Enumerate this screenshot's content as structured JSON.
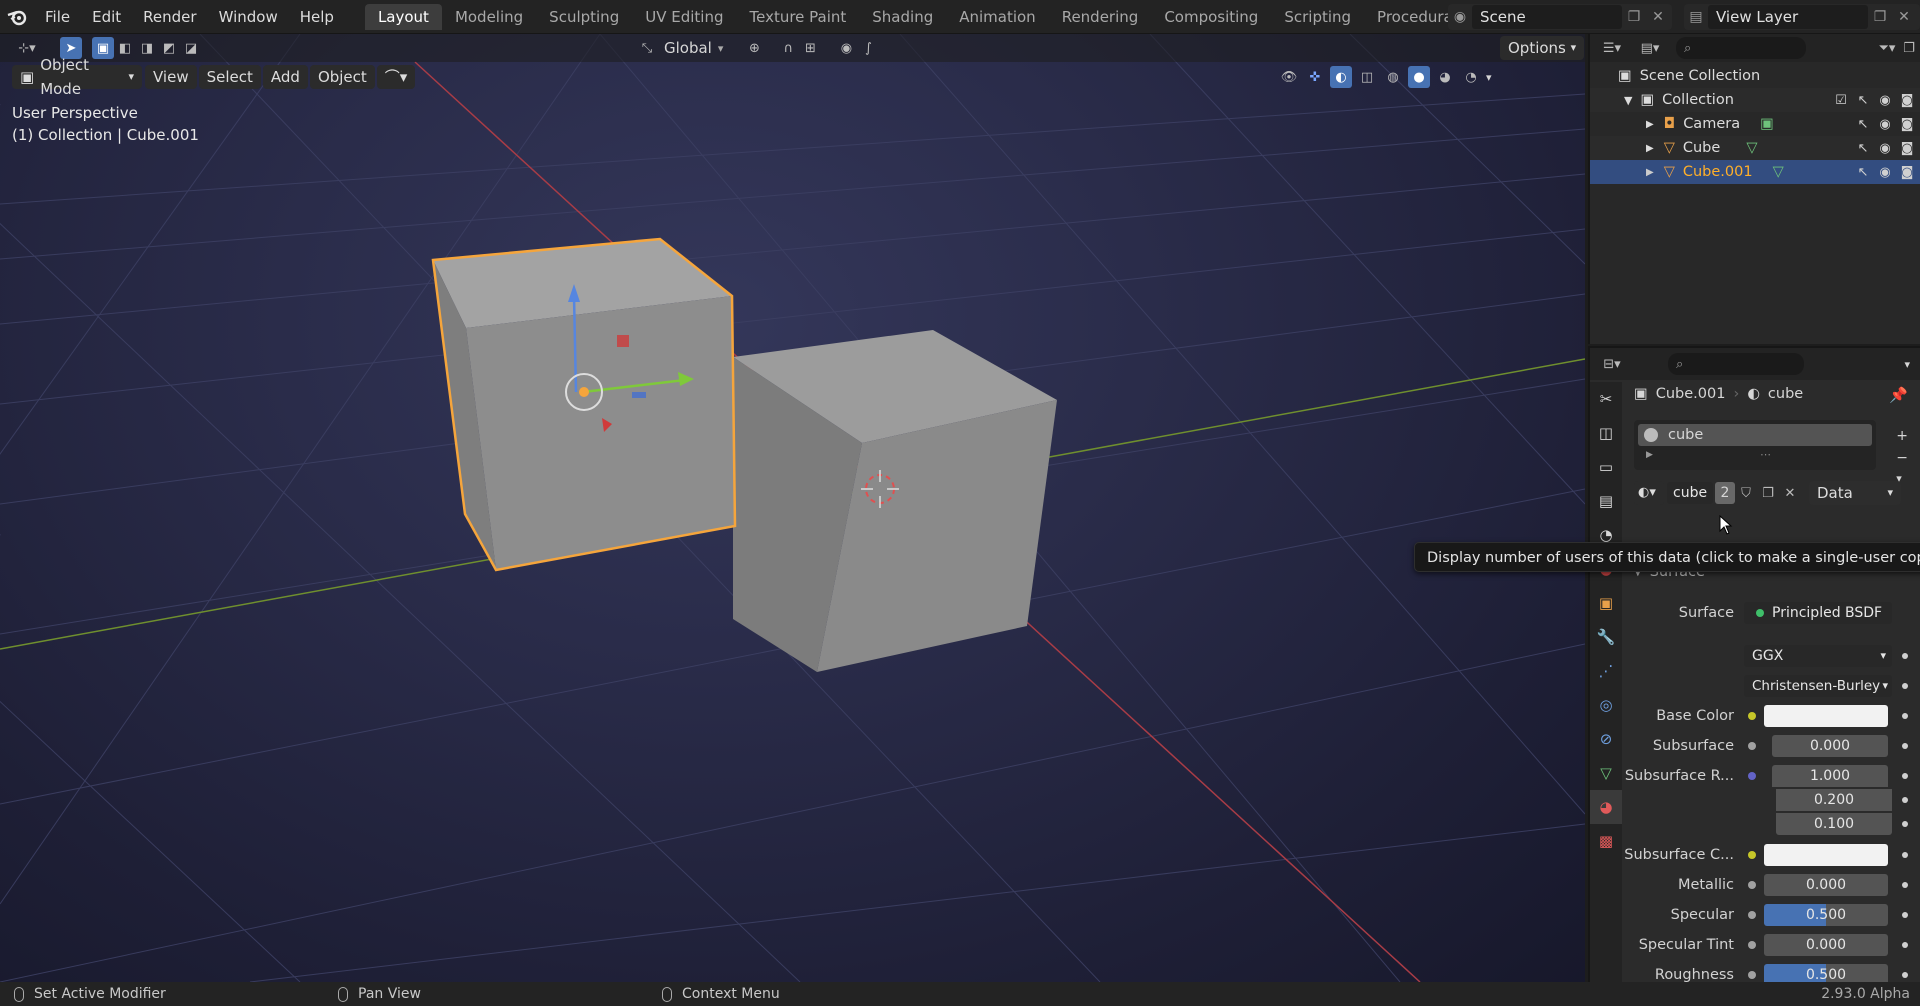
{
  "topbar": {
    "menus": [
      "File",
      "Edit",
      "Render",
      "Window",
      "Help"
    ],
    "workspaces": [
      "Layout",
      "Modeling",
      "Sculpting",
      "UV Editing",
      "Texture Paint",
      "Shading",
      "Animation",
      "Rendering",
      "Compositing",
      "Scripting",
      "Procedural"
    ],
    "active_workspace": "Layout",
    "scene": "Scene",
    "view_layer": "View Layer"
  },
  "viewport": {
    "transform_orientation": "Global",
    "options_label": "Options",
    "mode": "Object Mode",
    "menus": [
      "View",
      "Select",
      "Add",
      "Object"
    ],
    "perspective": "User Perspective",
    "context": "(1) Collection | Cube.001"
  },
  "outliner": {
    "root": "Scene Collection",
    "collection": "Collection",
    "items": [
      {
        "name": "Camera",
        "icon": "camera-icon"
      },
      {
        "name": "Cube",
        "icon": "mesh-icon"
      },
      {
        "name": "Cube.001",
        "icon": "mesh-icon",
        "selected": true
      }
    ]
  },
  "properties": {
    "breadcrumb_object": "Cube.001",
    "breadcrumb_material": "cube",
    "slot_name": "cube",
    "material_name": "cube",
    "user_count": "2",
    "link_mode": "Data",
    "surface_header": "Surface",
    "rows": [
      {
        "label": "Surface",
        "value": "Principled BSDF",
        "kind": "shader"
      },
      {
        "label": "",
        "value": "GGX",
        "kind": "dropdown"
      },
      {
        "label": "",
        "value": "Christensen-Burley",
        "kind": "dropdown"
      },
      {
        "label": "Base Color",
        "value": "",
        "kind": "color"
      },
      {
        "label": "Subsurface",
        "value": "0.000",
        "kind": "number"
      },
      {
        "label": "Subsurface R...",
        "value": "1.000",
        "kind": "number"
      },
      {
        "label": "",
        "value": "0.200",
        "kind": "number"
      },
      {
        "label": "",
        "value": "0.100",
        "kind": "number"
      },
      {
        "label": "Subsurface C...",
        "value": "",
        "kind": "color"
      },
      {
        "label": "Metallic",
        "value": "0.000",
        "kind": "number"
      },
      {
        "label": "Specular",
        "value": "0.500",
        "kind": "slider"
      },
      {
        "label": "Specular Tint",
        "value": "0.000",
        "kind": "number"
      },
      {
        "label": "Roughness",
        "value": "0.500",
        "kind": "slider"
      }
    ]
  },
  "tooltip": "Display number of users of this data (click to make a single-user copy).",
  "statusbar": {
    "left": "Set Active Modifier",
    "middle": "Pan View",
    "right": "Context Menu",
    "version": "2.93.0 Alpha"
  },
  "colors": {
    "accent": "#4772b3",
    "selected_text": "#ffaf29",
    "selection_outline": "#f5a53c"
  }
}
